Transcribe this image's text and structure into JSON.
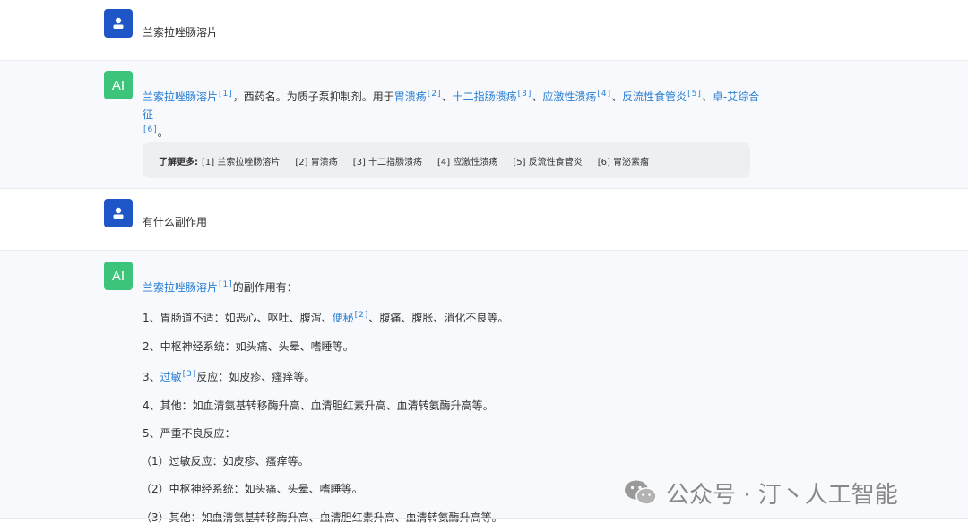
{
  "conversation": {
    "q1": "兰索拉唑肠溶片",
    "a1": {
      "avatar_text": "AI",
      "link_main": "兰索拉唑肠溶片",
      "ref_main": "[1]",
      "text1": "，西药名。为质子泵抑制剂。用于",
      "link_2": "胃溃疡",
      "ref_2": "[2]",
      "sep_a": "、",
      "link_3": "十二指肠溃疡",
      "ref_3": "[3]",
      "sep_b": "、",
      "link_4": "应激性溃疡",
      "ref_4": "[4]",
      "sep_c": "、",
      "link_5": "反流性食管炎",
      "ref_5": "[5]",
      "sep_d": "、",
      "link_6": "卓-艾综合征",
      "ref_6": "[6]",
      "end": "。"
    },
    "learn_more": {
      "label": "了解更多:",
      "items": [
        "[1]  兰索拉唑肠溶片",
        "[2]  胃溃疡",
        "[3]  十二指肠溃疡",
        "[4]  应激性溃疡",
        "[5]  反流性食管炎",
        "[6]  胃泌素瘤"
      ]
    },
    "q2": "有什么副作用",
    "a2": {
      "avatar_text": "AI",
      "intro_link": "兰索拉唑肠溶片",
      "intro_ref": "[1]",
      "intro_rest": "的副作用有：",
      "l1_pre": "1、胃肠道不适：如恶心、呕吐、腹泻、",
      "l1_link": "便秘",
      "l1_ref": "[2]",
      "l1_post": "、腹痛、腹胀、消化不良等。",
      "l2": "2、中枢神经系统：如头痛、头晕、嗜睡等。",
      "l3_pre": "3、",
      "l3_link": "过敏",
      "l3_ref": "[3]",
      "l3_post": "反应：如皮疹、瘙痒等。",
      "l4": "4、其他：如血清氨基转移酶升高、血清胆红素升高、血清转氨酶升高等。",
      "l5": "5、严重不良反应：",
      "l6": "（1）过敏反应：如皮疹、瘙痒等。",
      "l7": "（2）中枢神经系统：如头痛、头晕、嗜睡等。",
      "l8": "（3）其他：如血清氨基转移酶升高、血清胆红素升高、血清转氨酶升高等。"
    }
  },
  "watermark": "公众号 · 汀丶人工智能",
  "colors": {
    "link": "#2a7fd4",
    "user_avatar": "#1f56c7",
    "ai_avatar": "#3bc47a",
    "ai_row_bg": "#f7f9fc"
  }
}
